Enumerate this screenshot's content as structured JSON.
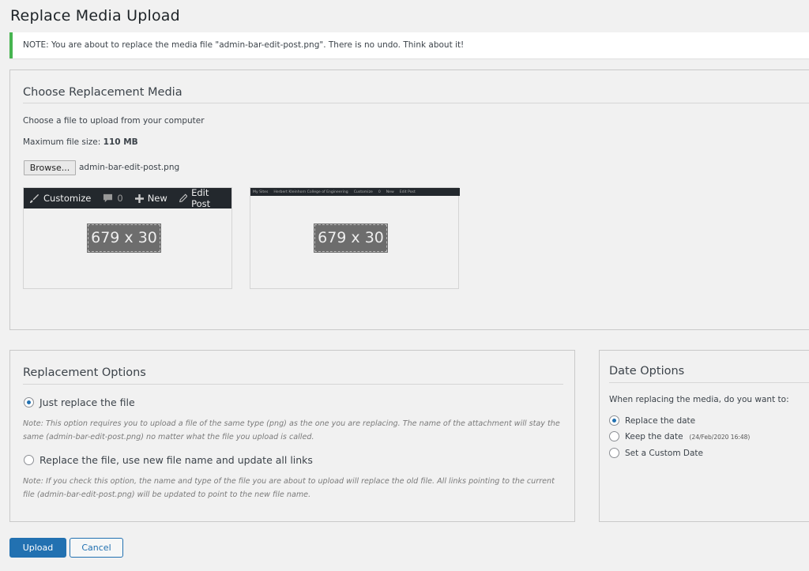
{
  "page": {
    "title": "Replace Media Upload",
    "notice": "NOTE: You are about to replace the media file \"admin-bar-edit-post.png\". There is no undo. Think about it!"
  },
  "choose": {
    "heading": "Choose Replacement Media",
    "instruction": "Choose a file to upload from your computer",
    "max_size_label": "Maximum file size:",
    "max_size_value": "110 MB",
    "browse_label": "Browse...",
    "selected_file": "admin-bar-edit-post.png",
    "preview_current": {
      "adminbar": {
        "customize": "Customize",
        "comments": "0",
        "new": "New",
        "edit_post": "Edit Post"
      },
      "placeholder": "679 x 30"
    },
    "preview_new": {
      "adminbar": {
        "my_sites": "My Sites",
        "site_name": "Herbert Kleinhorn College of Engineering",
        "customize": "Customize",
        "comments": "0",
        "new": "New",
        "edit_post": "Edit Post"
      },
      "placeholder": "679 x 30"
    }
  },
  "replacement": {
    "heading": "Replacement Options",
    "options": [
      {
        "label": "Just replace the file",
        "checked": true,
        "note": "Note: This option requires you to upload a file of the same type (png) as the one you are replacing. The name of the attachment will stay the same (admin-bar-edit-post.png) no matter what the file you upload is called."
      },
      {
        "label": "Replace the file, use new file name and update all links",
        "checked": false,
        "note": "Note: If you check this option, the name and type of the file you are about to upload will replace the old file. All links pointing to the current file (admin-bar-edit-post.png) will be updated to point to the new file name."
      }
    ]
  },
  "date": {
    "heading": "Date Options",
    "question": "When replacing the media, do you want to:",
    "options": [
      {
        "label": "Replace the date",
        "checked": true,
        "extra": ""
      },
      {
        "label": "Keep the date",
        "checked": false,
        "extra": "(24/Feb/2020 16:48)"
      },
      {
        "label": "Set a Custom Date",
        "checked": false,
        "extra": ""
      }
    ]
  },
  "actions": {
    "upload_label": "Upload",
    "cancel_label": "Cancel"
  },
  "colors": {
    "accent": "#2271b1",
    "notice_border": "#46b450",
    "adminbar_bg": "#23282d"
  }
}
